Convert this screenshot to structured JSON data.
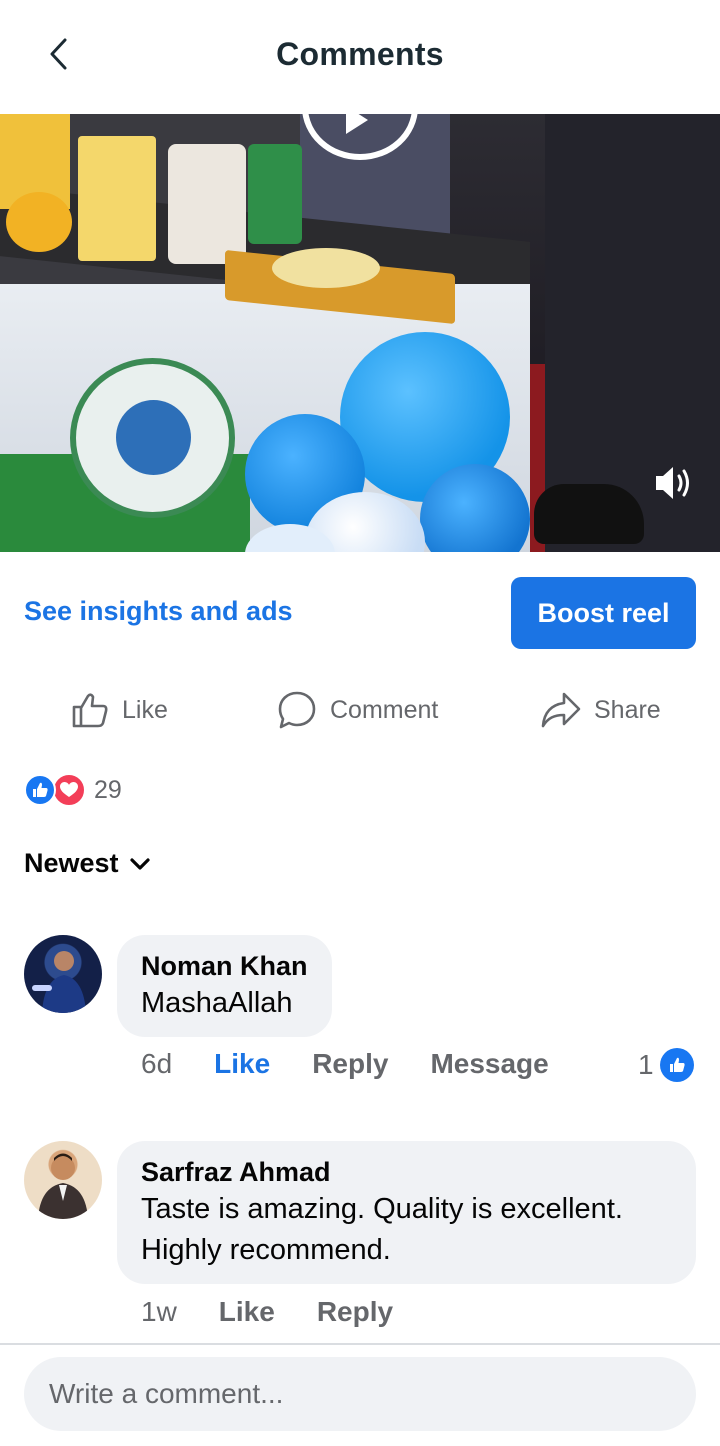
{
  "header": {
    "title": "Comments",
    "back_icon": "chevron-left-icon"
  },
  "video": {
    "play_icon": "play-icon",
    "volume_icon": "volume-icon"
  },
  "promo": {
    "insights_label": "See insights and ads",
    "boost_label": "Boost reel"
  },
  "actions": [
    {
      "label": "Like",
      "icon": "thumbs-up-icon"
    },
    {
      "label": "Comment",
      "icon": "comment-bubble-icon"
    },
    {
      "label": "Share",
      "icon": "share-arrow-icon"
    }
  ],
  "reactions": {
    "count": "29",
    "types": [
      "like",
      "love"
    ]
  },
  "sort": {
    "label": "Newest"
  },
  "comments": [
    {
      "author": "Noman Khan",
      "text": "MashaAllah",
      "time": "6d",
      "like_label": "Like",
      "reply_label": "Reply",
      "message_label": "Message",
      "likes": "1",
      "liked": true
    },
    {
      "author": "Sarfraz Ahmad",
      "text": "Taste is amazing. Quality is excellent. Highly recommend.",
      "time": "1w",
      "like_label": "Like",
      "reply_label": "Reply"
    }
  ],
  "composer": {
    "placeholder": "Write a comment..."
  },
  "colors": {
    "accent": "#1b74e4",
    "love": "#f33e58",
    "bubble": "#f0f2f5",
    "muted_text": "#65676b"
  }
}
